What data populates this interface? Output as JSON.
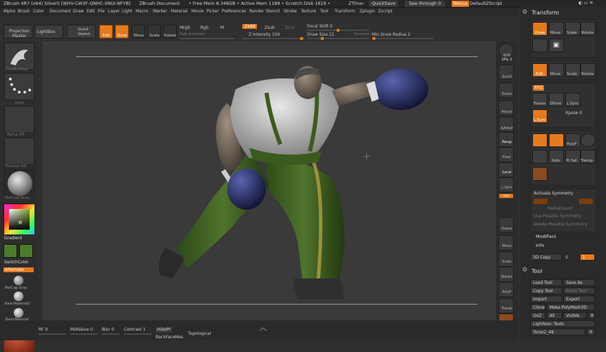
{
  "titlebar": {
    "app": "ZBrush 4R7 (x64) Silver5 [IKHV-CW3F-QNHC-XNUI-NFYB]",
    "document": "ZBrush Document",
    "mem": "• Free Mem 8.348GB • Active Mem 1189 • Scratch Disk 1619 •",
    "ztime": "ZTime›",
    "quicksave": "QuickSave",
    "seethrough": "See-through 0",
    "menus": "Menus",
    "script": "DefaultZScript"
  },
  "menubar": [
    "Alpha",
    "Brush",
    "Color",
    "Document",
    "Draw",
    "Edit",
    "File",
    "Layer",
    "Light",
    "Macro",
    "Marker",
    "Material",
    "Movie",
    "Picker",
    "Preferences",
    "Render",
    "Stencil",
    "Stroke",
    "Texture",
    "Tool",
    "Transform",
    "Zplugin",
    "Zscript"
  ],
  "toolbar": {
    "projection_master": "Projection Master",
    "lightbox": "LightBox",
    "quick_sketch": "Quick Sketch",
    "edit": "Edit",
    "draw": "Draw",
    "move": "Move",
    "scale": "Scale",
    "rotate": "Rotate",
    "mrgb": "Mrgb",
    "rgb": "Rgb",
    "m": "M",
    "rgb_intensity": "Rgb Intensity",
    "zadd": "Zadd",
    "zsub": "Zsub",
    "zcut": "Zcut",
    "z_intensity": "Z Intensity 100",
    "focal_shift": "Focal Shift 0",
    "draw_size": "Draw Size 21",
    "dynamic": "Dynamic",
    "min_draw_radius": "Min Draw Radius 2"
  },
  "leftpanel": {
    "brush": "ClayBuildup",
    "stroke": "Dots",
    "alpha": "Alpha Off",
    "texture": "Texture Off",
    "material": "MatCap Gray",
    "gradient": "Gradient",
    "switchcolor": "SwitchColor",
    "alternate": "Alternate",
    "mat1": "MatCap Gray",
    "mat2": "BasicMaterial2",
    "mat3": "BasicMaterial"
  },
  "shelf": [
    {
      "label": "BPR",
      "icon": "bpr-icon"
    },
    {
      "label": "SPix 3",
      "icon": "spix-icon"
    },
    {
      "label": "Scroll",
      "icon": "scroll-icon"
    },
    {
      "label": "Zoom",
      "icon": "zoom-icon"
    },
    {
      "label": "Actual",
      "icon": "actual-icon"
    },
    {
      "label": "AAHalf",
      "icon": "aahalf-icon"
    },
    {
      "label": "Persp",
      "icon": "persp-icon"
    },
    {
      "label": "Floor",
      "icon": "floor-icon"
    },
    {
      "label": "Local",
      "icon": "local-icon"
    },
    {
      "label": "L.Sym",
      "icon": "lsym-icon"
    },
    {
      "label": "xyz",
      "icon": "xyz-icon"
    },
    {
      "label": "Frame",
      "icon": "frame-icon"
    },
    {
      "label": "Move",
      "icon": "move-icon"
    },
    {
      "label": "Scale",
      "icon": "scale-icon"
    },
    {
      "label": "Rotate",
      "icon": "rotate-icon"
    },
    {
      "label": "PolyF",
      "icon": "polyf-icon"
    },
    {
      "label": "Transp",
      "icon": "transp-icon"
    }
  ],
  "tray": {
    "transform_title": "Transform",
    "draw": "Draw",
    "move": "Move",
    "scale": "Scale",
    "rotate": "Rotate",
    "edit": "Edit",
    "xyz": "XYZ",
    "frame": "Frame",
    "spivot": "SPivot",
    "lsym": "L.Sym",
    "xpose": "Xpose 0",
    "solo": "Solo",
    "ghost": "Ghost",
    "polyf": "PolyF",
    "transp": "Transp",
    "ptsel": "Pt Sel",
    "activate_symmetry": "Activate Symmetry",
    "radial_count": "RadialCount",
    "use_posable": "Use Posable Symmetry",
    "delete_posable": "Delete Posable Symmetry",
    "modifiers": "Modifiers",
    "info": "Info",
    "copy3d": "3D Copy",
    "copy_s": "S",
    "copy_n": "1",
    "tool_title": "Tool",
    "load_tool": "Load Tool",
    "save_as": "Save As",
    "copy_tool": "Copy Tool",
    "paste_tool": "Paste Tool",
    "import": "Import",
    "export": "Export",
    "clone": "Clone",
    "make_polymesh": "Make PolyMesh3D",
    "goz": "GoZ",
    "all": "All",
    "visible": "Visible",
    "r": "R",
    "lightbox_tools": "Lightbox› Tools",
    "subtool": "Torso2_48",
    "subtool_r": "R"
  },
  "bottombar": {
    "rf": "RF 0",
    "midvalue": "MidValue 0",
    "blur": "Blur 0",
    "contrast": "Contrast 1",
    "hidept": "HidePt",
    "topological": "Topological",
    "backfacemask": "BackFaceMas"
  },
  "colors": {
    "accent": "#e47a1e",
    "panel": "#2d2d2d",
    "canvas": "#3a3a3a"
  }
}
